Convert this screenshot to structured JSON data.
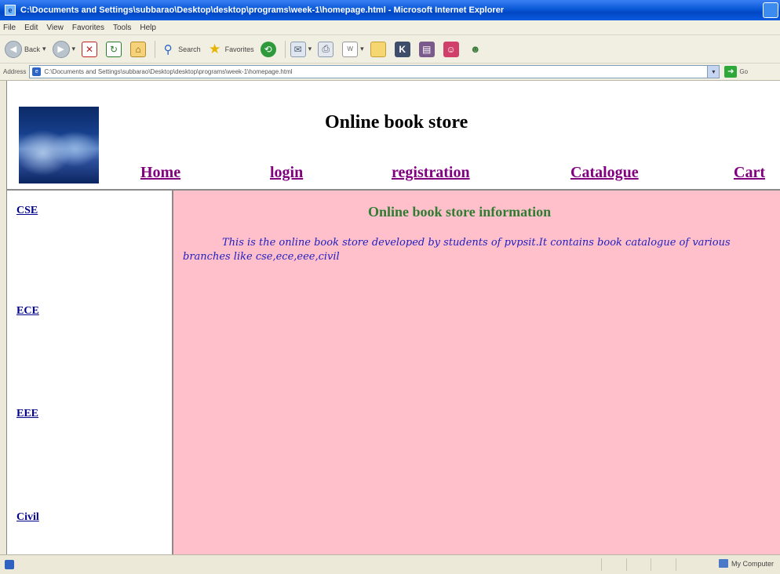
{
  "window": {
    "title": "C:\\Documents and Settings\\subbarao\\Desktop\\desktop\\programs\\week-1\\homepage.html - Microsoft Internet Explorer"
  },
  "menu": [
    "File",
    "Edit",
    "View",
    "Favorites",
    "Tools",
    "Help"
  ],
  "toolbar": {
    "back_label": "Back",
    "search_label": "Search",
    "favorites_label": "Favorites"
  },
  "address": {
    "label": "Address",
    "value": "C:\\Documents and Settings\\subbarao\\Desktop\\desktop\\programs\\week-1\\homepage.html",
    "go_label": "Go"
  },
  "page": {
    "site_title": "Online book store",
    "nav": [
      "Home",
      "login",
      "registration",
      "Catalogue",
      "Cart"
    ],
    "sidebar": [
      "CSE",
      "ECE",
      "EEE",
      "Civil"
    ],
    "content_title": "Online book store information",
    "content_text": "This is the online book store developed by students of pvpsit.It contains book catalogue of various branches like cse,ece,eee,civil"
  },
  "status": {
    "zone": "My Computer"
  },
  "colors": {
    "content_bg": "#ffc0cb",
    "nav_link": "#800080",
    "side_link": "#00008b",
    "content_title": "#2e7d32",
    "content_text": "#2020c0"
  }
}
